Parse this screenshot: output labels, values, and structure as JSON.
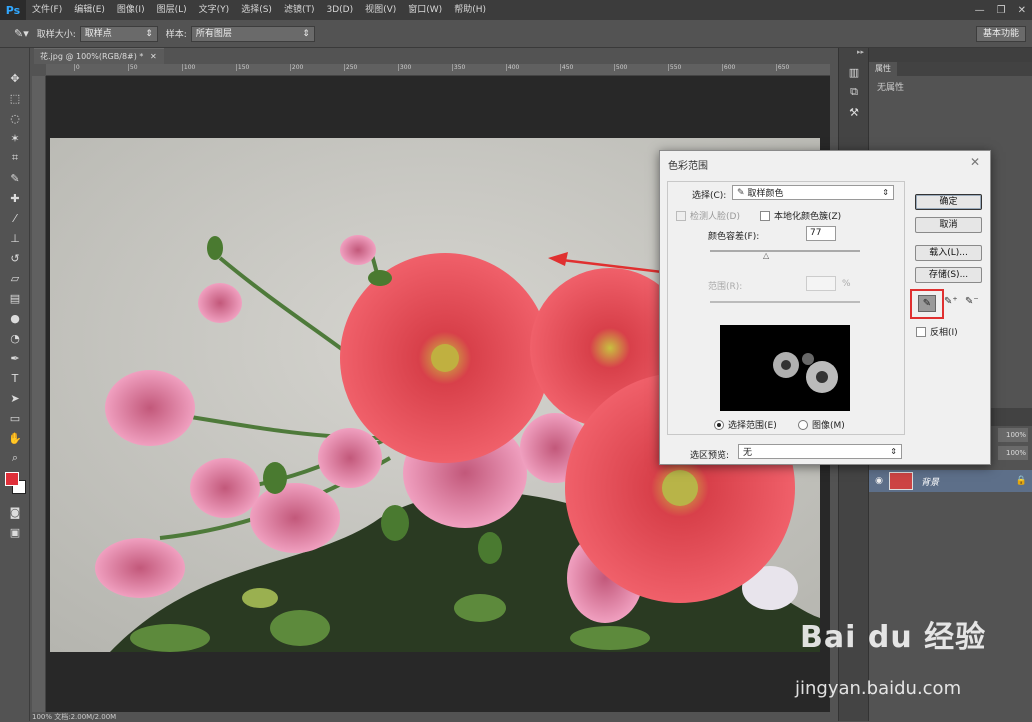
{
  "app": {
    "logo": "Ps"
  },
  "menu": [
    "文件(F)",
    "编辑(E)",
    "图像(I)",
    "图层(L)",
    "文字(Y)",
    "选择(S)",
    "滤镜(T)",
    "3D(D)",
    "视图(V)",
    "窗口(W)",
    "帮助(H)"
  ],
  "window_controls": [
    "—",
    "❐",
    "✕"
  ],
  "options": {
    "sample_size_label": "取样大小:",
    "sample_size_value": "取样点",
    "sample_label": "样本:",
    "sample_value": "所有图层",
    "workspace": "基本功能"
  },
  "document": {
    "tab": "花.jpg @ 100%(RGB/8#) *",
    "ruler_ticks": [
      "0",
      "50",
      "100",
      "150",
      "200",
      "250",
      "300",
      "350",
      "400",
      "450",
      "500",
      "550",
      "600",
      "650",
      "700",
      "750",
      "800",
      "850",
      "900",
      "950",
      "1000"
    ],
    "status": "100%  文档:2.00M/2.00M"
  },
  "right_panel": {
    "properties_tab": "属性",
    "properties_empty": "无属性",
    "layer_name": "背景",
    "opacity_100": "100%"
  },
  "dialog": {
    "title": "色彩范围",
    "select_label": "选择(C):",
    "select_value": "取样颜色",
    "detect_faces": "检测人脸(D)",
    "localized_clusters": "本地化颜色簇(Z)",
    "fuzziness_label": "颜色容差(F):",
    "fuzziness_value": "77",
    "range_label": "范围(R):",
    "range_unit": "%",
    "radio_selection": "选择范围(E)",
    "radio_image": "图像(M)",
    "preview_label": "选区预览:",
    "preview_value": "无",
    "ok": "确定",
    "cancel": "取消",
    "load": "载入(L)...",
    "save": "存储(S)...",
    "invert": "反相(I)",
    "close": "✕"
  },
  "watermark": {
    "brand": "Bai du 经验",
    "url": "jingyan.baidu.com"
  },
  "colors": {
    "highlight_red": "#e03030",
    "foreground": "#e0303a",
    "background": "#ffffff"
  }
}
